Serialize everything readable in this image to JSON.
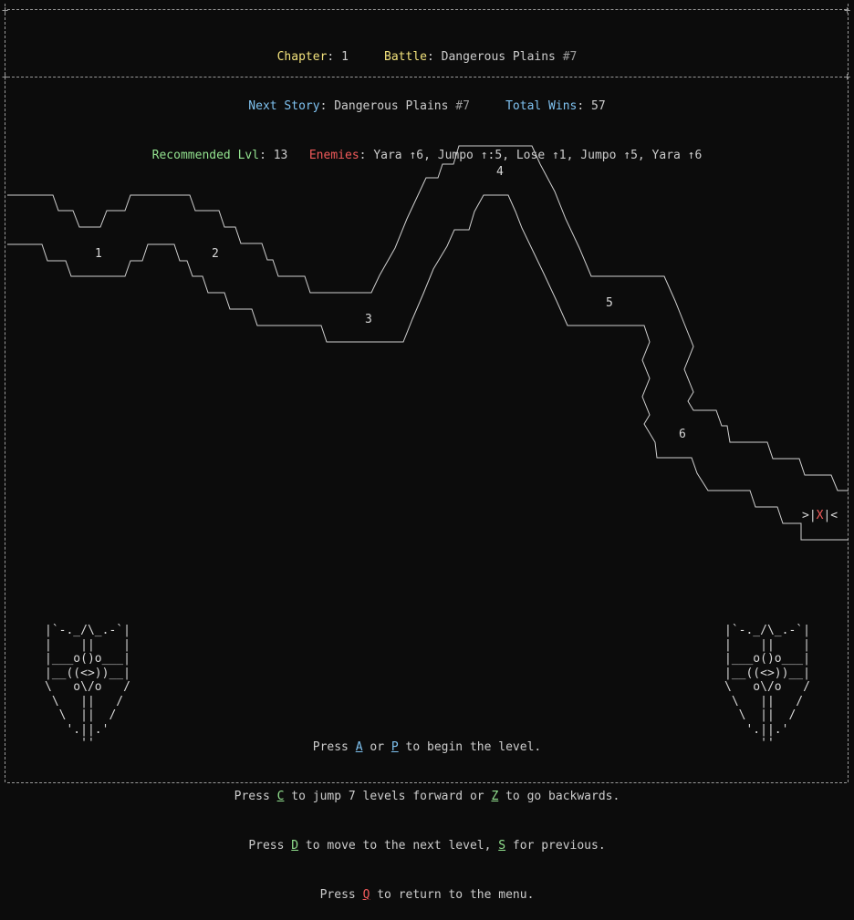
{
  "header": {
    "chapter_label": "Chapter",
    "chapter_value": "1",
    "battle_label": "Battle",
    "battle_value": "Dangerous Plains",
    "battle_num": "#7",
    "next_story_label": "Next Story",
    "next_story_value": "Dangerous Plains",
    "next_story_num": "#7",
    "total_wins_label": "Total Wins",
    "total_wins_value": "57",
    "rec_lvl_label": "Recommended Lvl",
    "rec_lvl_value": "13",
    "enemies_label": "Enemies",
    "enemies_value": "Yara ↑6, Jumpo ↑:5, Lose ↑1, Jumpo ↑5, Yara ↑6"
  },
  "map": {
    "levels": [
      "1",
      "2",
      "3",
      "4",
      "5",
      "6"
    ],
    "exit_left": ">|",
    "exit_x": "X",
    "exit_right": "|<"
  },
  "emblem_art": "|`-._/\\_.-`|\n|    ||    |\n|___o()o___|\n|__((<>))__|\n\\   o\\/o   /\n \\   ||   /\n  \\  ||  /\n   '.||.'\n     ''",
  "instructions": {
    "l1_a": "Press ",
    "l1_key1": "A",
    "l1_b": " or ",
    "l1_key2": "P",
    "l1_c": " to begin the level.",
    "l2_a": "Press ",
    "l2_key1": "C",
    "l2_b": " to jump 7 levels forward or ",
    "l2_key2": "Z",
    "l2_c": " to go backwards.",
    "l3_a": "Press ",
    "l3_key1": "D",
    "l3_b": " to move to the next level, ",
    "l3_key2": "S",
    "l3_c": " for previous.",
    "l4_a": "Press ",
    "l4_key1": "Q",
    "l4_b": " to return to the menu."
  },
  "colors": {
    "background": "#0c0c0c",
    "yellow": "#f2e27c",
    "cyan": "#7fc2f0",
    "green": "#93e28f",
    "red": "#f05a5a"
  }
}
